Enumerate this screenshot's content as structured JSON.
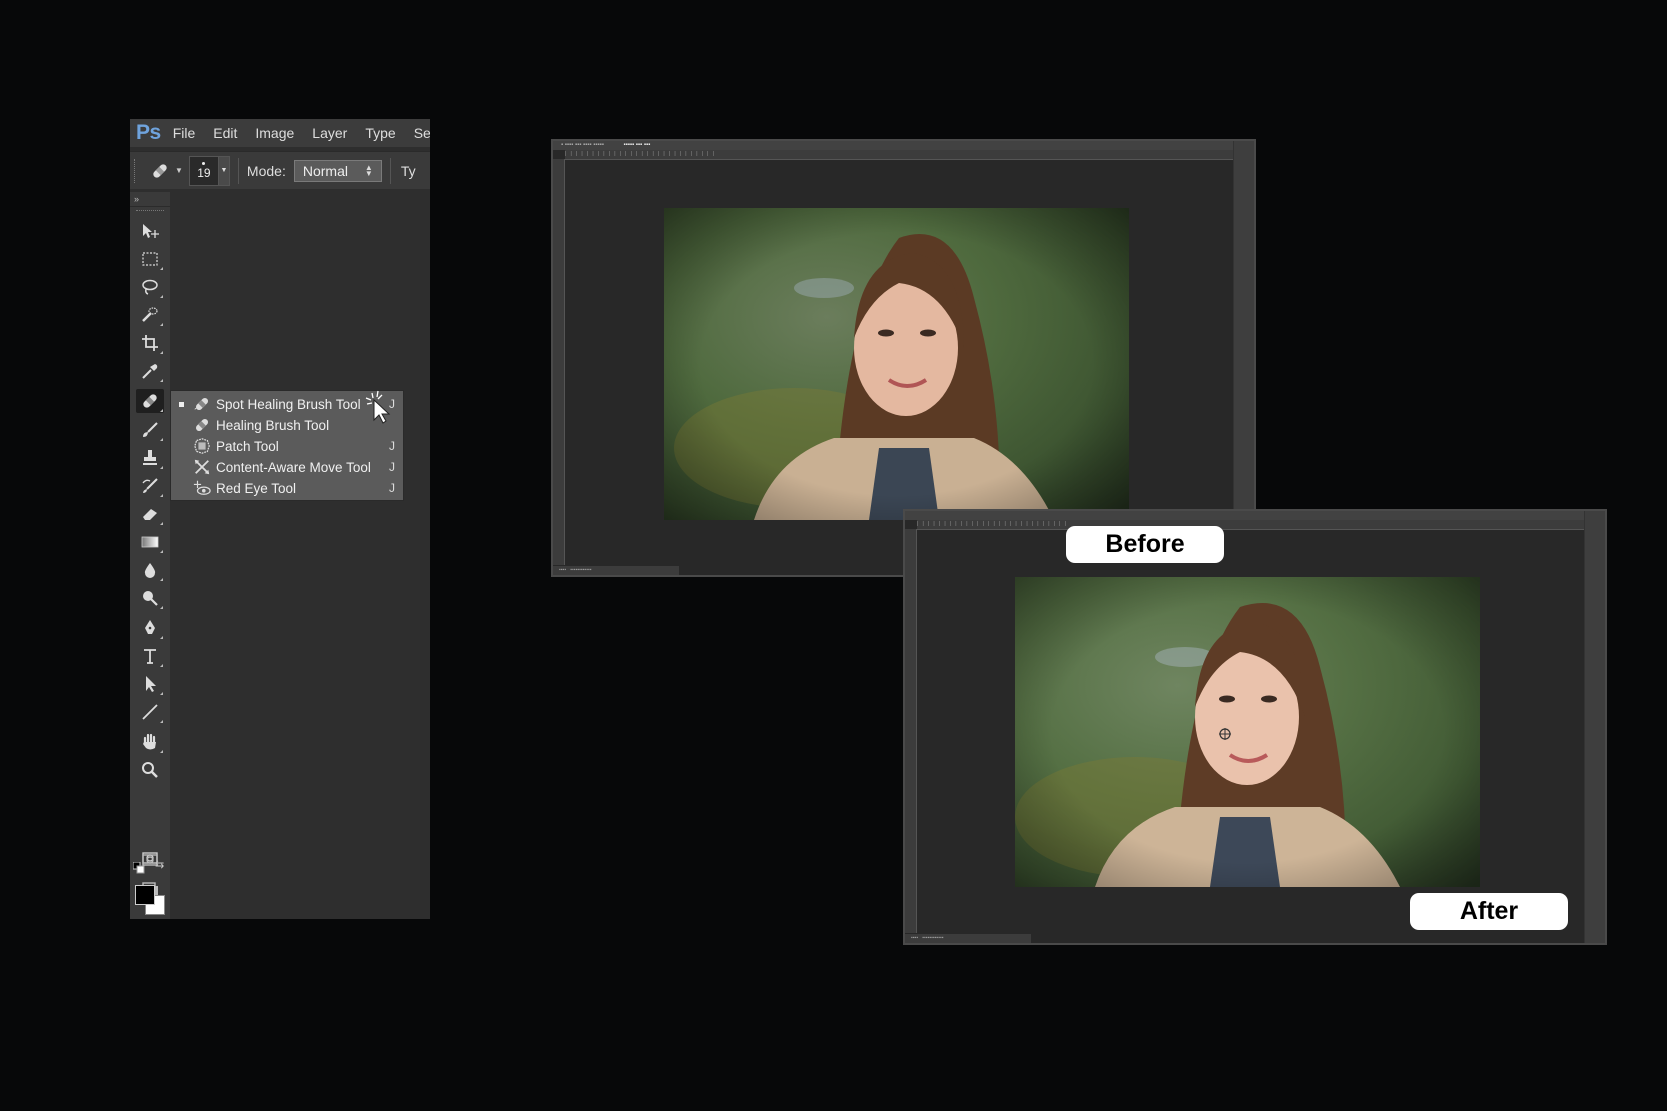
{
  "app": {
    "logo": "Ps"
  },
  "menubar": {
    "items": [
      "File",
      "Edit",
      "Image",
      "Layer",
      "Type",
      "Sele"
    ]
  },
  "options_bar": {
    "brush_size": "19",
    "mode_label": "Mode:",
    "mode_value": "Normal",
    "truncated_label": "Ty"
  },
  "toolbox": {
    "header": "»",
    "tools": [
      "move-tool-icon",
      "marquee-tool-icon",
      "lasso-tool-icon",
      "quick-selection-tool-icon",
      "crop-tool-icon",
      "eyedropper-tool-icon",
      "spot-healing-brush-tool-icon",
      "brush-tool-icon",
      "clone-stamp-tool-icon",
      "history-brush-tool-icon",
      "eraser-tool-icon",
      "gradient-tool-icon",
      "blur-tool-icon",
      "dodge-tool-icon",
      "pen-tool-icon",
      "type-tool-icon",
      "path-selection-tool-icon",
      "line-tool-icon",
      "hand-tool-icon",
      "zoom-tool-icon",
      "quick-mask-icon",
      "screen-mode-icon"
    ],
    "foreground_color": "#000000",
    "background_color": "#ffffff"
  },
  "flyout": {
    "items": [
      {
        "label": "Spot Healing Brush Tool",
        "shortcut": "J",
        "selected": true,
        "icon": "spot-healing-brush-icon"
      },
      {
        "label": "Healing Brush Tool",
        "shortcut": "",
        "selected": false,
        "icon": "healing-brush-icon"
      },
      {
        "label": "Patch Tool",
        "shortcut": "J",
        "selected": false,
        "icon": "patch-icon"
      },
      {
        "label": "Content-Aware Move Tool",
        "shortcut": "J",
        "selected": false,
        "icon": "content-aware-move-icon"
      },
      {
        "label": "Red Eye Tool",
        "shortcut": "J",
        "selected": false,
        "icon": "red-eye-icon"
      }
    ]
  },
  "documents": {
    "before": {
      "label": "Before"
    },
    "after": {
      "label": "After"
    }
  },
  "colors": {
    "page_background": "#070809",
    "panel_background": "#2e2e2e",
    "ps_logo_blue": "#6fa3dd",
    "label_pill": "#ffffff"
  }
}
